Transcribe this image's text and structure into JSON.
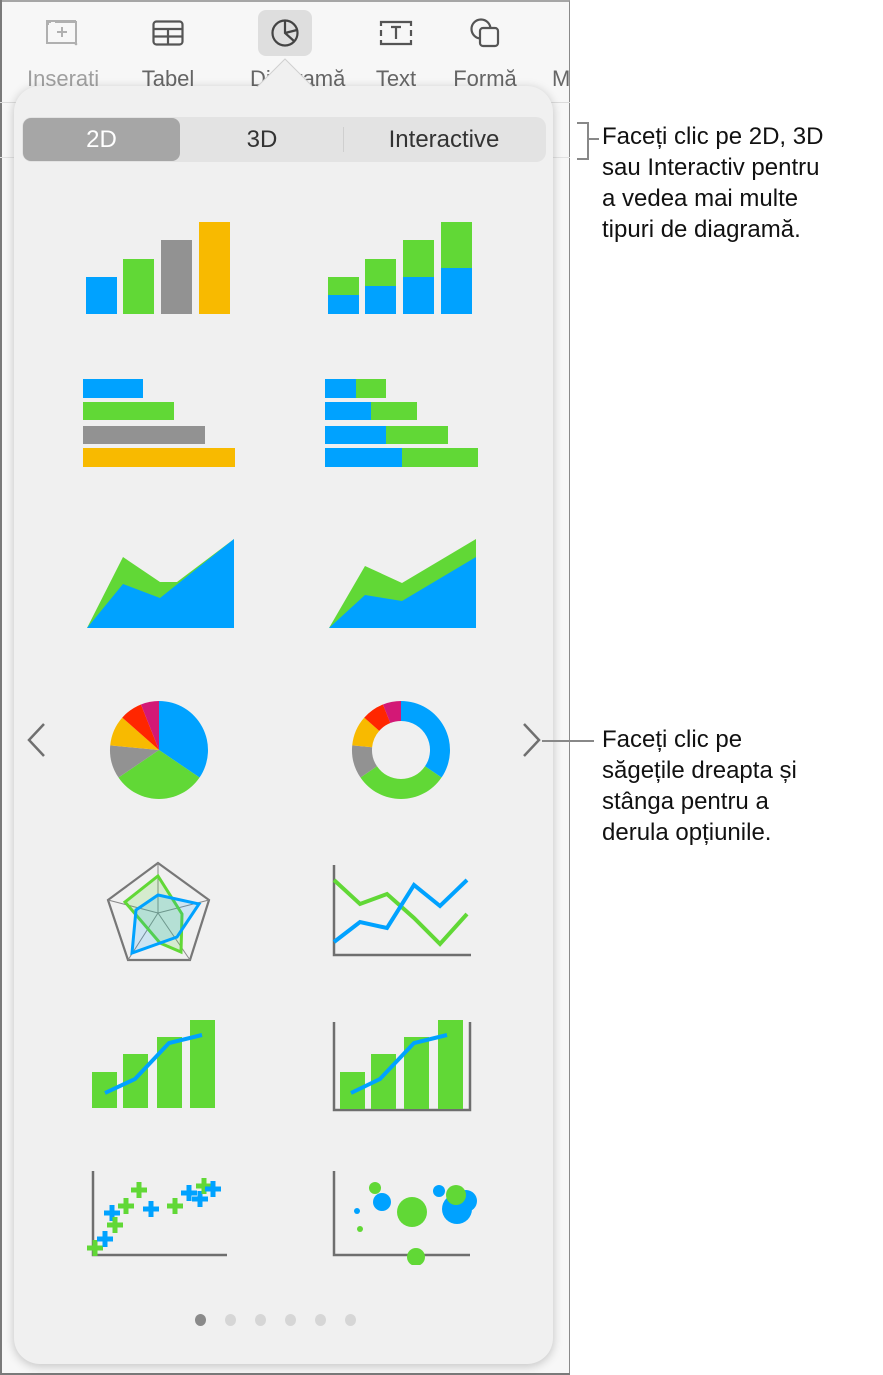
{
  "toolbar": {
    "items": [
      {
        "label": "Inserați",
        "icon": "insert-icon",
        "active": false
      },
      {
        "label": "Tabel",
        "icon": "table-icon",
        "active": false
      },
      {
        "label": "Diagramă",
        "icon": "chart-icon",
        "active": true
      },
      {
        "label": "Text",
        "icon": "text-box-icon",
        "active": false
      },
      {
        "label": "Formă",
        "icon": "shape-icon",
        "active": false
      },
      {
        "label": "M",
        "icon": "media-icon",
        "active": false
      }
    ]
  },
  "segmented": {
    "options": [
      "2D",
      "3D",
      "Interactive"
    ],
    "selected": "2D"
  },
  "chart_types": [
    {
      "name": "column",
      "label": "Column chart"
    },
    {
      "name": "stacked-column",
      "label": "Stacked column chart"
    },
    {
      "name": "bar",
      "label": "Bar chart"
    },
    {
      "name": "stacked-bar",
      "label": "Stacked bar chart"
    },
    {
      "name": "area",
      "label": "Area chart"
    },
    {
      "name": "stacked-area",
      "label": "Stacked area chart"
    },
    {
      "name": "pie",
      "label": "Pie chart"
    },
    {
      "name": "donut",
      "label": "Donut chart"
    },
    {
      "name": "radar",
      "label": "Radar chart"
    },
    {
      "name": "line",
      "label": "Line chart"
    },
    {
      "name": "mixed",
      "label": "Mixed chart"
    },
    {
      "name": "two-axis",
      "label": "Two-axis chart"
    },
    {
      "name": "scatter",
      "label": "Scatter chart"
    },
    {
      "name": "bubble",
      "label": "Bubble chart"
    }
  ],
  "colors": {
    "blue": "#00a2ff",
    "green": "#61d836",
    "gray": "#929292",
    "yellow": "#f8ba00",
    "red": "#ff2600",
    "magenta": "#d31876",
    "axis": "#6e6e6e"
  },
  "pagination": {
    "total": 6,
    "current": 1
  },
  "navigation": {
    "prev": "chevron-left",
    "next": "chevron-right"
  },
  "callouts": {
    "segments": [
      "Faceți clic pe 2D, 3D",
      "sau Interactiv pentru",
      "a vedea mai multe",
      "tipuri de diagramă."
    ],
    "arrows": [
      "Faceți clic pe",
      "săgețile dreapta și",
      "stânga pentru a",
      "derula opțiunile."
    ]
  }
}
